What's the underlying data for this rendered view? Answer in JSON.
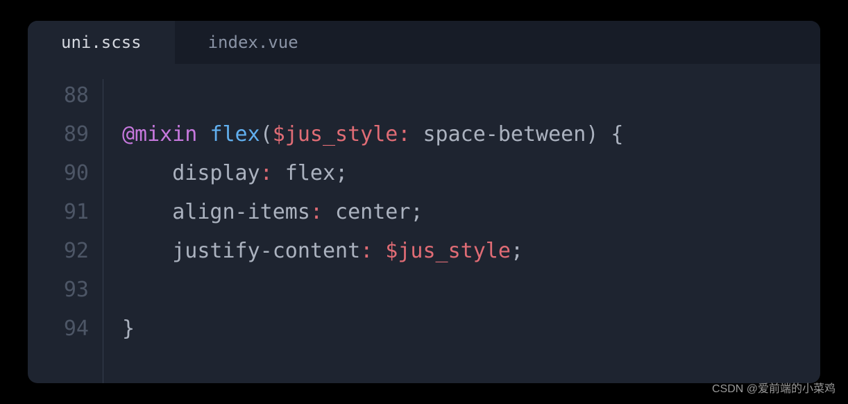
{
  "tabs": [
    {
      "label": "uni.scss",
      "active": true
    },
    {
      "label": "index.vue",
      "active": false
    }
  ],
  "gutter": {
    "start": 88,
    "lines": [
      "88",
      "89",
      "90",
      "91",
      "92",
      "93",
      "94"
    ]
  },
  "code": {
    "line88": "",
    "line89_keyword": "@mixin",
    "line89_func": "flex",
    "line89_paren_open": "(",
    "line89_var": "$jus_style",
    "line89_colon": ":",
    "line89_value": " space-between",
    "line89_paren_close": ")",
    "line89_brace": " {",
    "line90_prop": "display",
    "line90_colon": ":",
    "line90_value": " flex",
    "line90_semi": ";",
    "line91_prop": "align-items",
    "line91_colon": ":",
    "line91_value": " center",
    "line91_semi": ";",
    "line92_prop": "justify-content",
    "line92_colon": ":",
    "line92_var": " $jus_style",
    "line92_semi": ";",
    "line93": "",
    "line94_brace": "}"
  },
  "watermark": "CSDN @爱前端的小菜鸡"
}
